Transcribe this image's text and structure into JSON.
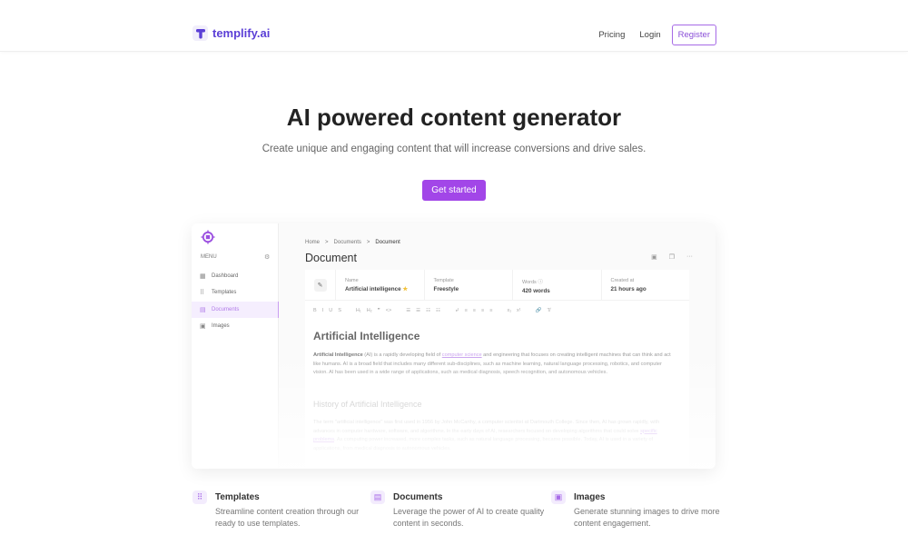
{
  "nav": {
    "brand": "templify.ai",
    "links": [
      "Pricing",
      "Login"
    ],
    "register": "Register",
    "brand_color": "#5b3fd6"
  },
  "hero": {
    "title": "AI powered content generator",
    "subtitle": "Create unique and engaging content that will increase conversions and drive sales.",
    "cta": "Get started",
    "accent": "#a246e8"
  },
  "app": {
    "menu_label": "MENU",
    "sidebar": [
      {
        "label": "Dashboard",
        "icon": "dashboard-icon",
        "glyph": "▦"
      },
      {
        "label": "Templates",
        "icon": "grid-icon",
        "glyph": "⠿"
      },
      {
        "label": "Documents",
        "icon": "document-icon",
        "glyph": "▤",
        "active": true
      },
      {
        "label": "Images",
        "icon": "image-icon",
        "glyph": "▣"
      }
    ],
    "breadcrumb": [
      "Home",
      "Documents",
      "Document"
    ],
    "breadcrumb_sep": ">",
    "title": "Document",
    "info": [
      {
        "key": "Name",
        "value": "Artificial intelligence"
      },
      {
        "key": "Template",
        "value": "Freestyle"
      },
      {
        "key": "Words ⓘ",
        "value": "420 words"
      },
      {
        "key": "Created at",
        "value": "21 hours ago"
      }
    ],
    "toolbar": [
      "B",
      "I",
      "U",
      "S",
      "|",
      "H₁",
      "H₂",
      "❞",
      "<>",
      "|",
      "☰",
      "☰",
      "☷",
      "☷",
      "|",
      "↲",
      "≡",
      "≡",
      "≡",
      "≡",
      "|",
      "x₁",
      "x¹",
      "|",
      "🔗",
      "T̸"
    ],
    "heading": "Artificial Intelligence",
    "p1_bold": "Artificial Intelligence",
    "p1_a": " (AI) is a rapidly developing field of ",
    "p1_link": "computer science",
    "p1_b": " and engineering that focuses on creating intelligent machines that can think and act like humans. AI is a broad field that includes many different sub-disciplines, such as machine learning, natural language processing, robotics, and computer vision. AI has been used in a wide range of applications, such as medical diagnosis, speech recognition, and autonomous vehicles.",
    "heading2": "History of Artificial Intelligence",
    "p2_a": "The term \"artificial intelligence\" was first used in 1956 by John McCarthy, a computer scientist at Dartmouth College. Since then, AI has grown rapidly, with advances in computer hardware, software, and algorithms. In the early days of AI, researchers focused on developing algorithms that could solve ",
    "p2_link": "specific problems",
    "p2_b": ". As computing power increased, more complex tasks, such as natural language processing, became possible. Today, AI is used in a variety of applications, from medical diagnosis to autonomous vehicles."
  },
  "features": [
    {
      "title": "Templates",
      "desc": "Streamline content creation through our ready to use templates.",
      "icon": "grid-icon",
      "glyph": "⠿"
    },
    {
      "title": "Documents",
      "desc": "Leverage the power of AI to create quality content in seconds.",
      "icon": "document-icon",
      "glyph": "▤"
    },
    {
      "title": "Images",
      "desc": "Generate stunning images to drive more content engagement.",
      "icon": "image-icon",
      "glyph": "▣"
    }
  ]
}
